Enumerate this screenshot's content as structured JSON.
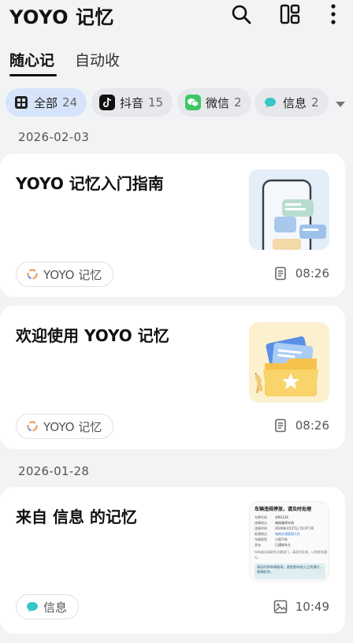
{
  "app": {
    "title": "YOYO 记忆",
    "icons": [
      "search-icon",
      "layout-icon",
      "more-vert-icon"
    ]
  },
  "tabs": [
    {
      "label": "随心记",
      "active": true
    },
    {
      "label": "自动收",
      "active": false
    }
  ],
  "filters": [
    {
      "label": "全部",
      "count": "24",
      "icon": "grid-icon",
      "active": true
    },
    {
      "label": "抖音",
      "count": "15",
      "icon": "douyin-icon",
      "active": false
    },
    {
      "label": "微信",
      "count": "2",
      "icon": "wechat-icon",
      "active": false
    },
    {
      "label": "信息",
      "count": "2",
      "icon": "message-icon",
      "active": false
    }
  ],
  "groups": [
    {
      "date": "2026-02-03",
      "items": [
        {
          "title": "YOYO 记忆入门指南",
          "source": "YOYO 记忆",
          "time": "08:26",
          "type_icon": "document-icon"
        },
        {
          "title": "欢迎使用 YOYO 记忆",
          "source": "YOYO 记忆",
          "time": "08:26",
          "type_icon": "document-icon"
        }
      ]
    },
    {
      "date": "2026-01-28",
      "items": [
        {
          "title": "来自 信息 的记忆",
          "source": "信息",
          "time": "10:49",
          "type_icon": "image-icon"
        }
      ]
    }
  ],
  "thumb3": {
    "header": "车辆违规停放，请及时处理",
    "rows": [
      {
        "k": "车牌号码",
        "v": "京B1234"
      },
      {
        "k": "违章地点",
        "v": "城南路停车场"
      },
      {
        "k": "违章时间",
        "v": "2026年1月27日 15:07:10"
      },
      {
        "k": "处理地点",
        "v": "城南交通管理大队"
      },
      {
        "k": "车辆类型",
        "v": "小型汽车"
      },
      {
        "k": "状态",
        "v": "已通知车主"
      }
    ],
    "note": "如有疑问请联系交管部门，请及时处理，以免影响通行。",
    "footer": "请及时将车辆驶离，避免影响他人正常通行，感谢配合。"
  },
  "colors": {
    "accent_chip": "#d6e4fb",
    "background": "#f2f3f5",
    "card": "#ffffff"
  }
}
